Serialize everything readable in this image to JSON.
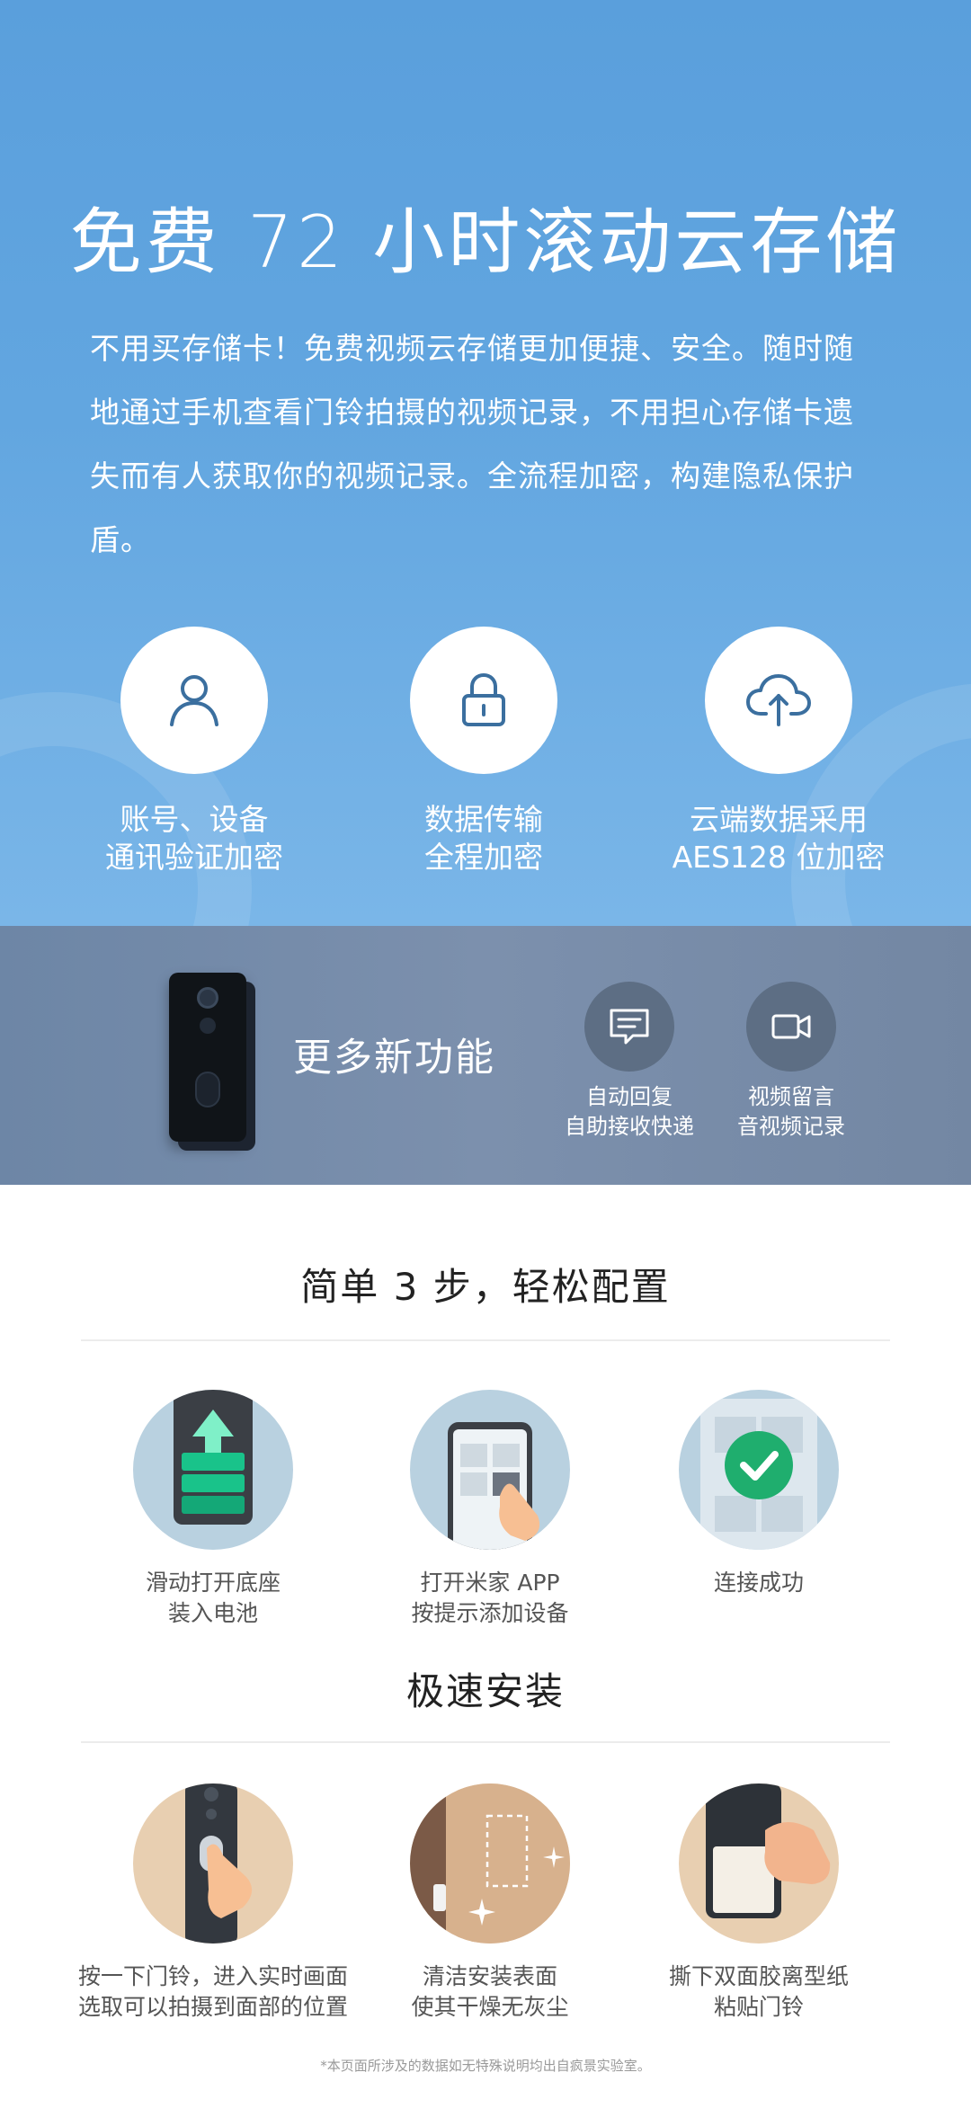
{
  "cloud": {
    "title": "免费 72 小时滚动云存储",
    "description": "不用买存储卡！免费视频云存储更加便捷、安全。随时随地通过手机查看门铃拍摄的视频记录，不用担心存储卡遗失而有人获取你的视频记录。全流程加密，构建隐私保护盾。",
    "features": [
      {
        "icon": "user-icon",
        "line1": "账号、设备",
        "line2": "通讯验证加密"
      },
      {
        "icon": "lock-icon",
        "line1": "数据传输",
        "line2": "全程加密"
      },
      {
        "icon": "cloud-upload-icon",
        "line1": "云端数据采用",
        "line2": "AES128 位加密"
      }
    ]
  },
  "more": {
    "title": "更多新功能",
    "features": [
      {
        "icon": "message-icon",
        "line1": "自动回复",
        "line2": "自助接收快递"
      },
      {
        "icon": "video-icon",
        "line1": "视频留言",
        "line2": "音视频记录"
      }
    ]
  },
  "setup": {
    "title": "简单 3 步，轻松配置",
    "steps": [
      {
        "icon": "battery-icon",
        "line1": "滑动打开底座",
        "line2": "装入电池"
      },
      {
        "icon": "phone-app-icon",
        "line1": "打开米家 APP",
        "line2": "按提示添加设备"
      },
      {
        "icon": "check-icon",
        "line1": "连接成功",
        "line2": ""
      }
    ]
  },
  "install": {
    "title": "极速安装",
    "steps": [
      {
        "icon": "press-doorbell-icon",
        "line1": "按一下门铃，进入实时画面",
        "line2": "选取可以拍摄到面部的位置"
      },
      {
        "icon": "clean-surface-icon",
        "line1": "清洁安装表面",
        "line2": "使其干燥无灰尘"
      },
      {
        "icon": "peel-tape-icon",
        "line1": "撕下双面胶离型纸",
        "line2": "粘贴门铃"
      }
    ]
  },
  "footnote": "*本页面所涉及的数据如无特殊说明均出自疯景实验室。",
  "colors": {
    "cloud_bg": "#5a9fdc",
    "more_bg": "#7387a3",
    "icon_stroke": "#3b6f9f",
    "check_green": "#1fae6e"
  }
}
